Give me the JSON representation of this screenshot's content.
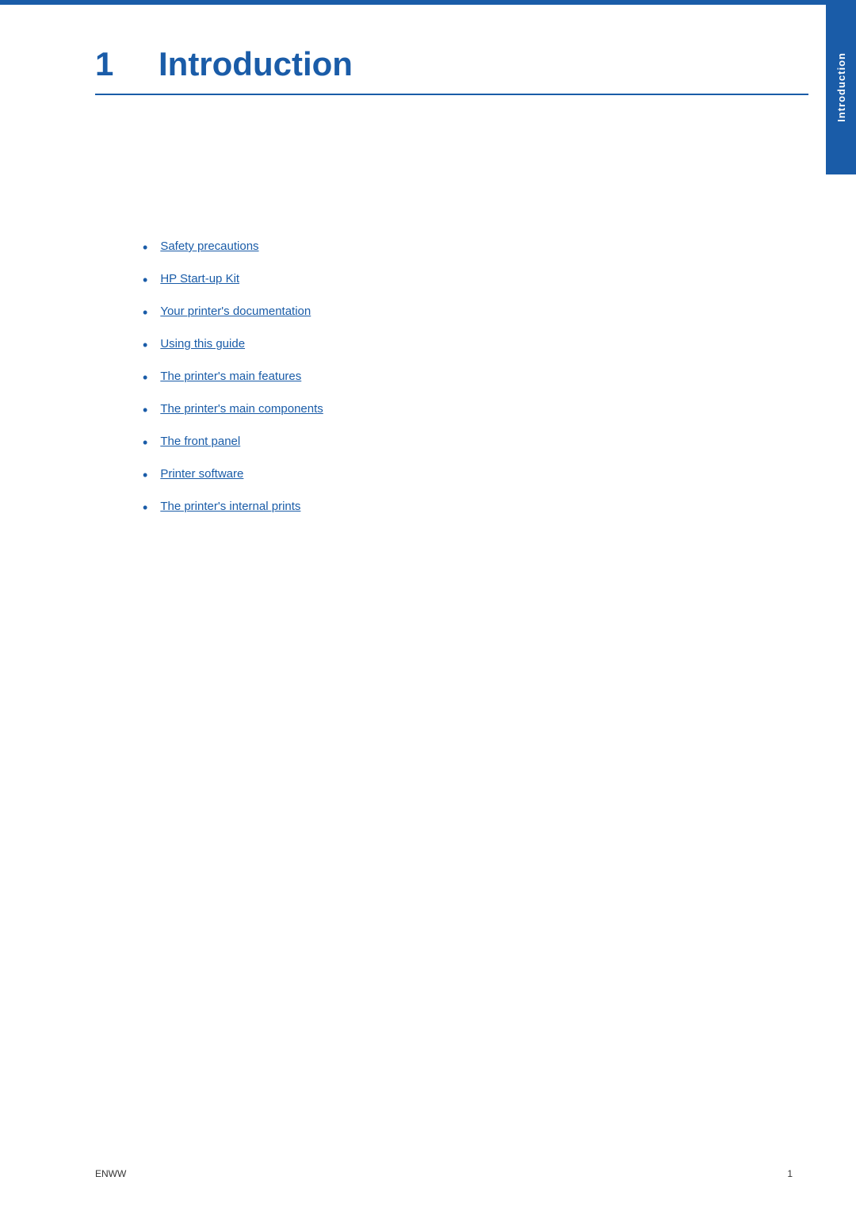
{
  "page": {
    "chapter_number": "1",
    "chapter_title": "Introduction",
    "side_tab_label": "Introduction",
    "footer_left": "ENWW",
    "footer_right": "1",
    "toc_items": [
      {
        "id": "safety-precautions",
        "label": "Safety precautions"
      },
      {
        "id": "hp-startup-kit",
        "label": "HP Start-up Kit"
      },
      {
        "id": "printer-documentation",
        "label": "Your printer's documentation"
      },
      {
        "id": "using-this-guide",
        "label": "Using this guide"
      },
      {
        "id": "main-features",
        "label": "The printer's main features"
      },
      {
        "id": "main-components",
        "label": "The printer's main components"
      },
      {
        "id": "front-panel",
        "label": "The front panel"
      },
      {
        "id": "printer-software",
        "label": "Printer software"
      },
      {
        "id": "internal-prints",
        "label": "The printer's internal prints"
      }
    ]
  }
}
